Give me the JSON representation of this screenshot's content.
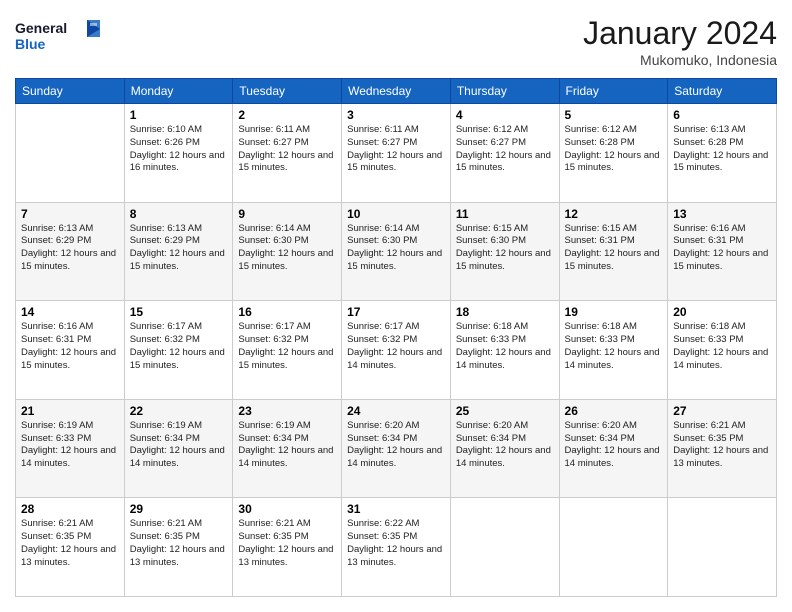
{
  "header": {
    "logo": {
      "general": "General",
      "blue": "Blue"
    },
    "title": "January 2024",
    "subtitle": "Mukomuko, Indonesia"
  },
  "calendar": {
    "days_of_week": [
      "Sunday",
      "Monday",
      "Tuesday",
      "Wednesday",
      "Thursday",
      "Friday",
      "Saturday"
    ],
    "weeks": [
      [
        {
          "day": "",
          "sunrise": "",
          "sunset": "",
          "daylight": ""
        },
        {
          "day": "1",
          "sunrise": "Sunrise: 6:10 AM",
          "sunset": "Sunset: 6:26 PM",
          "daylight": "Daylight: 12 hours and 16 minutes."
        },
        {
          "day": "2",
          "sunrise": "Sunrise: 6:11 AM",
          "sunset": "Sunset: 6:27 PM",
          "daylight": "Daylight: 12 hours and 15 minutes."
        },
        {
          "day": "3",
          "sunrise": "Sunrise: 6:11 AM",
          "sunset": "Sunset: 6:27 PM",
          "daylight": "Daylight: 12 hours and 15 minutes."
        },
        {
          "day": "4",
          "sunrise": "Sunrise: 6:12 AM",
          "sunset": "Sunset: 6:27 PM",
          "daylight": "Daylight: 12 hours and 15 minutes."
        },
        {
          "day": "5",
          "sunrise": "Sunrise: 6:12 AM",
          "sunset": "Sunset: 6:28 PM",
          "daylight": "Daylight: 12 hours and 15 minutes."
        },
        {
          "day": "6",
          "sunrise": "Sunrise: 6:13 AM",
          "sunset": "Sunset: 6:28 PM",
          "daylight": "Daylight: 12 hours and 15 minutes."
        }
      ],
      [
        {
          "day": "7",
          "sunrise": "Sunrise: 6:13 AM",
          "sunset": "Sunset: 6:29 PM",
          "daylight": "Daylight: 12 hours and 15 minutes."
        },
        {
          "day": "8",
          "sunrise": "Sunrise: 6:13 AM",
          "sunset": "Sunset: 6:29 PM",
          "daylight": "Daylight: 12 hours and 15 minutes."
        },
        {
          "day": "9",
          "sunrise": "Sunrise: 6:14 AM",
          "sunset": "Sunset: 6:30 PM",
          "daylight": "Daylight: 12 hours and 15 minutes."
        },
        {
          "day": "10",
          "sunrise": "Sunrise: 6:14 AM",
          "sunset": "Sunset: 6:30 PM",
          "daylight": "Daylight: 12 hours and 15 minutes."
        },
        {
          "day": "11",
          "sunrise": "Sunrise: 6:15 AM",
          "sunset": "Sunset: 6:30 PM",
          "daylight": "Daylight: 12 hours and 15 minutes."
        },
        {
          "day": "12",
          "sunrise": "Sunrise: 6:15 AM",
          "sunset": "Sunset: 6:31 PM",
          "daylight": "Daylight: 12 hours and 15 minutes."
        },
        {
          "day": "13",
          "sunrise": "Sunrise: 6:16 AM",
          "sunset": "Sunset: 6:31 PM",
          "daylight": "Daylight: 12 hours and 15 minutes."
        }
      ],
      [
        {
          "day": "14",
          "sunrise": "Sunrise: 6:16 AM",
          "sunset": "Sunset: 6:31 PM",
          "daylight": "Daylight: 12 hours and 15 minutes."
        },
        {
          "day": "15",
          "sunrise": "Sunrise: 6:17 AM",
          "sunset": "Sunset: 6:32 PM",
          "daylight": "Daylight: 12 hours and 15 minutes."
        },
        {
          "day": "16",
          "sunrise": "Sunrise: 6:17 AM",
          "sunset": "Sunset: 6:32 PM",
          "daylight": "Daylight: 12 hours and 15 minutes."
        },
        {
          "day": "17",
          "sunrise": "Sunrise: 6:17 AM",
          "sunset": "Sunset: 6:32 PM",
          "daylight": "Daylight: 12 hours and 14 minutes."
        },
        {
          "day": "18",
          "sunrise": "Sunrise: 6:18 AM",
          "sunset": "Sunset: 6:33 PM",
          "daylight": "Daylight: 12 hours and 14 minutes."
        },
        {
          "day": "19",
          "sunrise": "Sunrise: 6:18 AM",
          "sunset": "Sunset: 6:33 PM",
          "daylight": "Daylight: 12 hours and 14 minutes."
        },
        {
          "day": "20",
          "sunrise": "Sunrise: 6:18 AM",
          "sunset": "Sunset: 6:33 PM",
          "daylight": "Daylight: 12 hours and 14 minutes."
        }
      ],
      [
        {
          "day": "21",
          "sunrise": "Sunrise: 6:19 AM",
          "sunset": "Sunset: 6:33 PM",
          "daylight": "Daylight: 12 hours and 14 minutes."
        },
        {
          "day": "22",
          "sunrise": "Sunrise: 6:19 AM",
          "sunset": "Sunset: 6:34 PM",
          "daylight": "Daylight: 12 hours and 14 minutes."
        },
        {
          "day": "23",
          "sunrise": "Sunrise: 6:19 AM",
          "sunset": "Sunset: 6:34 PM",
          "daylight": "Daylight: 12 hours and 14 minutes."
        },
        {
          "day": "24",
          "sunrise": "Sunrise: 6:20 AM",
          "sunset": "Sunset: 6:34 PM",
          "daylight": "Daylight: 12 hours and 14 minutes."
        },
        {
          "day": "25",
          "sunrise": "Sunrise: 6:20 AM",
          "sunset": "Sunset: 6:34 PM",
          "daylight": "Daylight: 12 hours and 14 minutes."
        },
        {
          "day": "26",
          "sunrise": "Sunrise: 6:20 AM",
          "sunset": "Sunset: 6:34 PM",
          "daylight": "Daylight: 12 hours and 14 minutes."
        },
        {
          "day": "27",
          "sunrise": "Sunrise: 6:21 AM",
          "sunset": "Sunset: 6:35 PM",
          "daylight": "Daylight: 12 hours and 13 minutes."
        }
      ],
      [
        {
          "day": "28",
          "sunrise": "Sunrise: 6:21 AM",
          "sunset": "Sunset: 6:35 PM",
          "daylight": "Daylight: 12 hours and 13 minutes."
        },
        {
          "day": "29",
          "sunrise": "Sunrise: 6:21 AM",
          "sunset": "Sunset: 6:35 PM",
          "daylight": "Daylight: 12 hours and 13 minutes."
        },
        {
          "day": "30",
          "sunrise": "Sunrise: 6:21 AM",
          "sunset": "Sunset: 6:35 PM",
          "daylight": "Daylight: 12 hours and 13 minutes."
        },
        {
          "day": "31",
          "sunrise": "Sunrise: 6:22 AM",
          "sunset": "Sunset: 6:35 PM",
          "daylight": "Daylight: 12 hours and 13 minutes."
        },
        {
          "day": "",
          "sunrise": "",
          "sunset": "",
          "daylight": ""
        },
        {
          "day": "",
          "sunrise": "",
          "sunset": "",
          "daylight": ""
        },
        {
          "day": "",
          "sunrise": "",
          "sunset": "",
          "daylight": ""
        }
      ]
    ]
  }
}
